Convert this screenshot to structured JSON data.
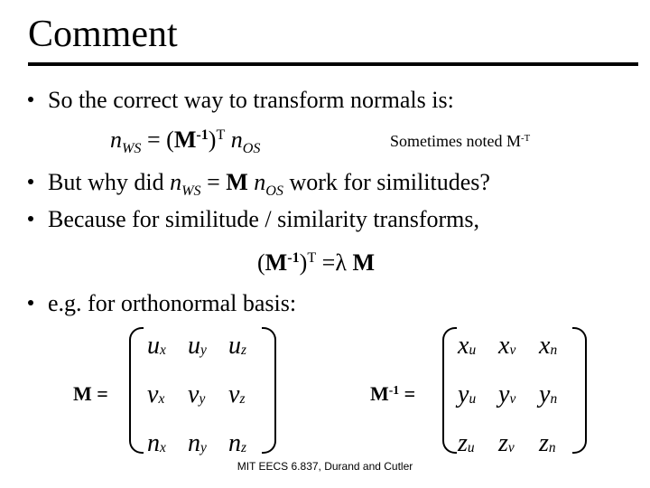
{
  "slide": {
    "title": "Comment",
    "bullets": [
      {
        "text": "So the correct way to transform normals is:"
      },
      {
        "pre": "But why did ",
        "eq_n": "n",
        "eq_sub1": "WS",
        "eq_mid": " = ",
        "eq_M": "M",
        "eq_n2": " n",
        "eq_sub2": "OS",
        "post": " work for similitudes?"
      },
      {
        "text": "Because for similitude / similarity transforms,"
      },
      {
        "text": "e.g. for orthonormal basis:"
      }
    ],
    "equation1": {
      "n": "n",
      "sub_ws": "WS",
      "eq": " = (",
      "M": "M",
      "sup_inv": "-1",
      "close": ")",
      "sup_T": "T",
      "n2": " n",
      "sub_os": "OS"
    },
    "note": {
      "text": "Sometimes noted M",
      "sup": "-T"
    },
    "equation2": {
      "open": "(",
      "M": "M",
      "sup_inv": "-1",
      "close": ")",
      "sup_T": "T",
      "eq": " =",
      "lambda": "λ",
      "M2": " M"
    },
    "matrix_M": {
      "label": "M =",
      "rows": [
        [
          {
            "b": "u",
            "s": "x"
          },
          {
            "b": "u",
            "s": "y"
          },
          {
            "b": "u",
            "s": "z"
          }
        ],
        [
          {
            "b": "v",
            "s": "x"
          },
          {
            "b": "v",
            "s": "y"
          },
          {
            "b": "v",
            "s": "z"
          }
        ],
        [
          {
            "b": "n",
            "s": "x"
          },
          {
            "b": "n",
            "s": "y"
          },
          {
            "b": "n",
            "s": "z"
          }
        ]
      ]
    },
    "matrix_Minv": {
      "label": "M",
      "label_sup": "-1",
      "label_eq": " =",
      "rows": [
        [
          {
            "b": "x",
            "s": "u"
          },
          {
            "b": "x",
            "s": "v"
          },
          {
            "b": "x",
            "s": "n"
          }
        ],
        [
          {
            "b": "y",
            "s": "u"
          },
          {
            "b": "y",
            "s": "v"
          },
          {
            "b": "y",
            "s": "n"
          }
        ],
        [
          {
            "b": "z",
            "s": "u"
          },
          {
            "b": "z",
            "s": "v"
          },
          {
            "b": "z",
            "s": "n"
          }
        ]
      ]
    },
    "footer": "MIT EECS 6.837, Durand and Cutler"
  }
}
